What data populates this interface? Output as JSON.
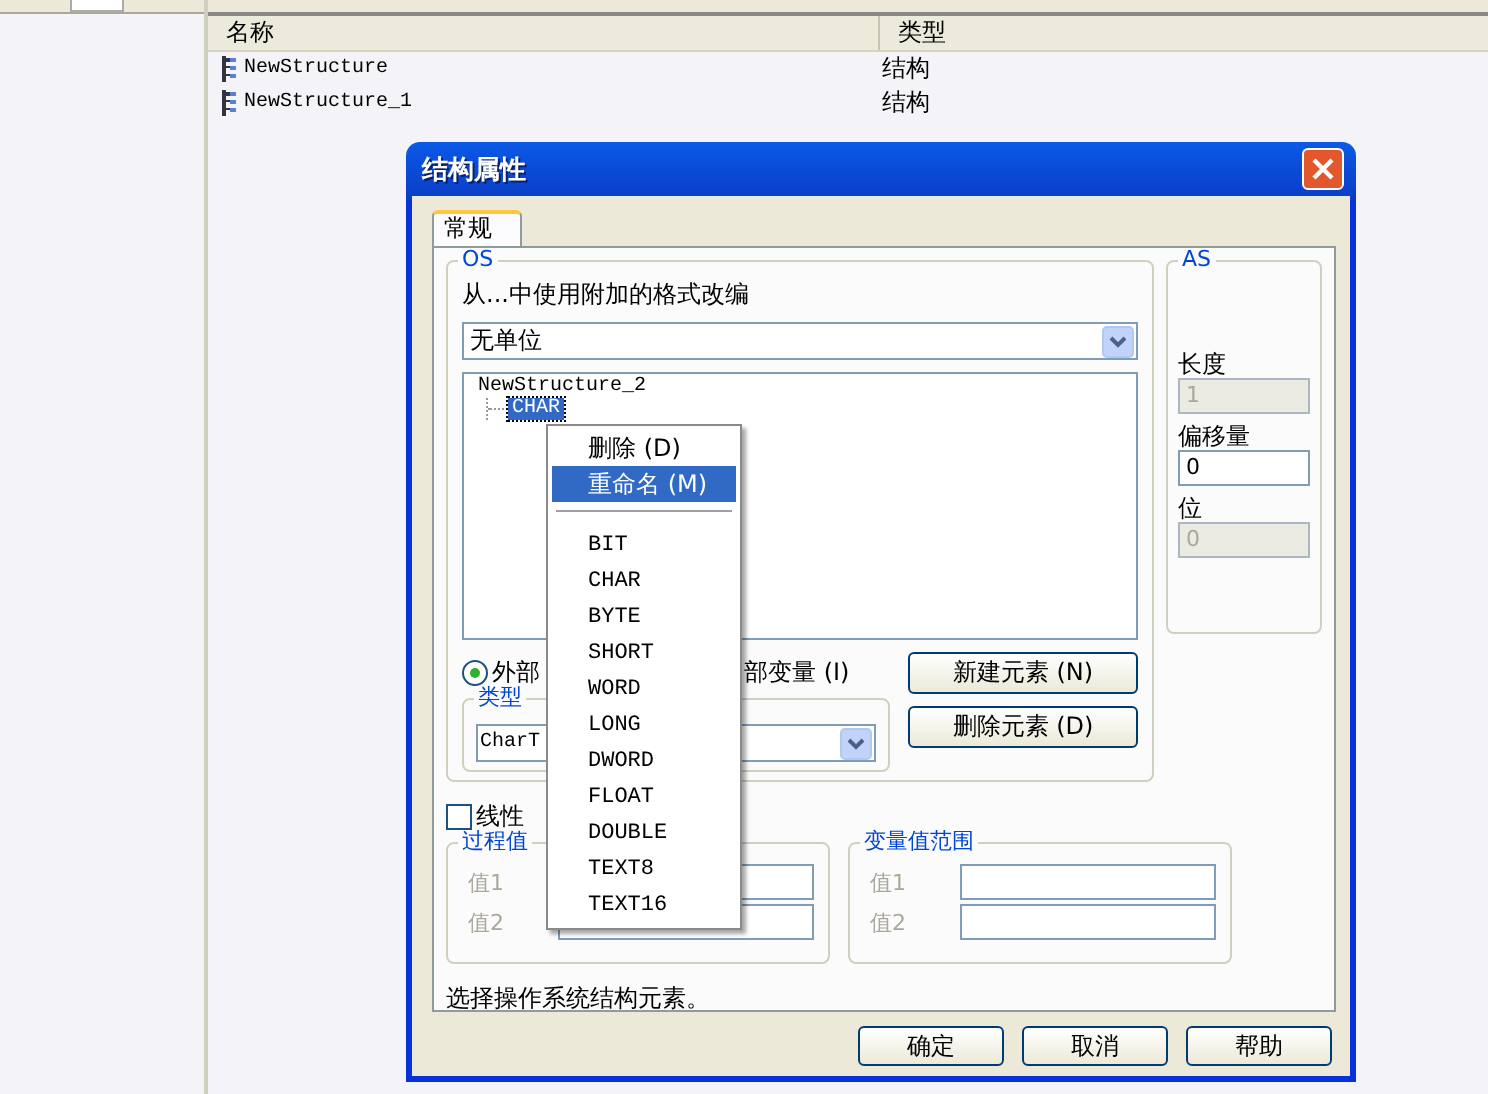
{
  "list": {
    "columns": [
      "名称",
      "类型"
    ],
    "rows": [
      {
        "name": "NewStructure",
        "type": "结构"
      },
      {
        "name": "NewStructure_1",
        "type": "结构"
      }
    ]
  },
  "dialog": {
    "title": "结构属性",
    "tabs": [
      {
        "label": "常规",
        "selected": true
      }
    ],
    "os": {
      "label": "OS",
      "format_label": "从...中使用附加的格式改编",
      "format_value": "无单位",
      "tree": {
        "label": "NewStructure_2",
        "children": [
          {
            "label": "CHAR",
            "selected": true
          }
        ]
      },
      "radio": {
        "label": "外部",
        "selected": true
      },
      "internal_label": "部变量 (I)",
      "type_group": {
        "label": "类型",
        "value": "CharT"
      },
      "buttons": [
        "新建元素 (N)",
        "删除元素 (D)"
      ]
    },
    "as": {
      "label": "AS",
      "fields": [
        {
          "label": "长度",
          "value": "1",
          "disabled": true
        },
        {
          "label": "偏移量",
          "value": "0",
          "disabled": false
        },
        {
          "label": "位",
          "value": "0",
          "disabled": true
        }
      ]
    },
    "linear": {
      "label": "线性",
      "checked": false
    },
    "ranges": [
      {
        "label": "过程值",
        "rows": [
          "值1",
          "值2"
        ]
      },
      {
        "label": "变量值范围",
        "rows": [
          "值1",
          "值2"
        ]
      }
    ],
    "status": "选择操作系统结构元素。",
    "buttons": [
      "确定",
      "取消",
      "帮助"
    ]
  },
  "context_menu": {
    "items": [
      {
        "kind": "command",
        "label": "删除 (D)",
        "selected": false
      },
      {
        "kind": "command",
        "label": "重命名 (M)",
        "selected": true
      },
      {
        "kind": "separator"
      },
      {
        "kind": "command",
        "label": "BIT",
        "selected": false
      },
      {
        "kind": "command",
        "label": "CHAR",
        "selected": false
      },
      {
        "kind": "command",
        "label": "BYTE",
        "selected": false
      },
      {
        "kind": "command",
        "label": "SHORT",
        "selected": false
      },
      {
        "kind": "command",
        "label": "WORD",
        "selected": false
      },
      {
        "kind": "command",
        "label": "LONG",
        "selected": false
      },
      {
        "kind": "command",
        "label": "DWORD",
        "selected": false
      },
      {
        "kind": "command",
        "label": "FLOAT",
        "selected": false
      },
      {
        "kind": "command",
        "label": "DOUBLE",
        "selected": false
      },
      {
        "kind": "command",
        "label": "TEXT8",
        "selected": false
      },
      {
        "kind": "command",
        "label": "TEXT16",
        "selected": false
      }
    ]
  }
}
